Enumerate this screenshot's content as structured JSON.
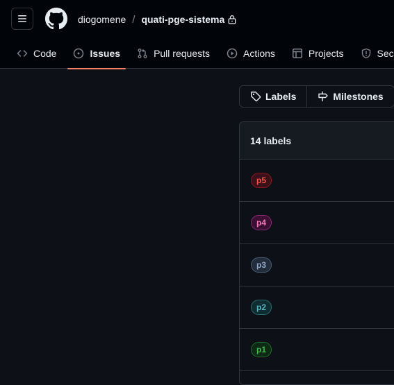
{
  "repo": {
    "owner": "diogomene",
    "separator": "/",
    "name": "quati-pge-sistema"
  },
  "tabs": [
    {
      "label": "Code",
      "icon": "code-icon",
      "active": false
    },
    {
      "label": "Issues",
      "icon": "issue-opened-icon",
      "active": true
    },
    {
      "label": "Pull requests",
      "icon": "git-pull-request-icon",
      "active": false
    },
    {
      "label": "Actions",
      "icon": "play-icon",
      "active": false
    },
    {
      "label": "Projects",
      "icon": "table-icon",
      "active": false
    },
    {
      "label": "Secu",
      "icon": "shield-icon",
      "active": false
    }
  ],
  "subnav": {
    "labels": "Labels",
    "milestones": "Milestones"
  },
  "labels_box": {
    "count_text": "14 labels",
    "labels": [
      {
        "name": "p5",
        "color": "#f85149",
        "bg": "#3b1219",
        "border": "#8e1519"
      },
      {
        "name": "p4",
        "color": "#f778ba",
        "bg": "#3a0f32",
        "border": "#8a2a78"
      },
      {
        "name": "p3",
        "color": "#8fa7c4",
        "bg": "#222c3a",
        "border": "#4a5a70"
      },
      {
        "name": "p2",
        "color": "#56b6c2",
        "bg": "#0f2d30",
        "border": "#2a6a72"
      },
      {
        "name": "p1",
        "color": "#3fb950",
        "bg": "#0f2a14",
        "border": "#1f6a2c"
      }
    ]
  },
  "colors": {
    "accent": "#f78166",
    "bg": "#0d1117",
    "header_bg": "#010409",
    "border": "#30363d"
  }
}
